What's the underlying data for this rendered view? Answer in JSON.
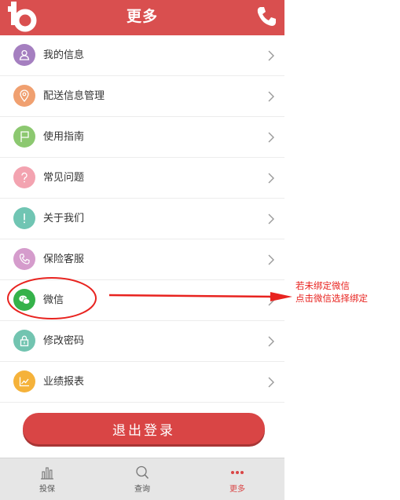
{
  "header": {
    "title": "更多",
    "logo_icon": "logo-b-icon",
    "phone_icon": "phone-icon",
    "bg": "#d94f4f"
  },
  "menu": [
    {
      "label": "我的信息",
      "icon": "user-icon",
      "color": "#a57fc0"
    },
    {
      "label": "配送信息管理",
      "icon": "location-pin-icon",
      "color": "#f0a070"
    },
    {
      "label": "使用指南",
      "icon": "flag-icon",
      "color": "#8cc870"
    },
    {
      "label": "常见问题",
      "icon": "question-icon",
      "color": "#f3a3b0"
    },
    {
      "label": "关于我们",
      "icon": "exclamation-icon",
      "color": "#70c5b3"
    },
    {
      "label": "保险客服",
      "icon": "phone-icon",
      "color": "#d59ccc"
    },
    {
      "label": "微信",
      "icon": "wechat-icon",
      "color": "#35b24a"
    },
    {
      "label": "修改密码",
      "icon": "lock-icon",
      "color": "#72c4b0"
    },
    {
      "label": "业绩报表",
      "icon": "chart-icon",
      "color": "#f5b23a"
    }
  ],
  "logout_label": "退出登录",
  "tabs": [
    {
      "label": "投保",
      "icon": "bar-chart-icon"
    },
    {
      "label": "查询",
      "icon": "search-icon"
    },
    {
      "label": "更多",
      "icon": "more-dots-icon",
      "active": true
    }
  ],
  "annotation": {
    "line1": "若未绑定微信",
    "line2": "点击微信选择绑定",
    "color": "#e8231f"
  }
}
